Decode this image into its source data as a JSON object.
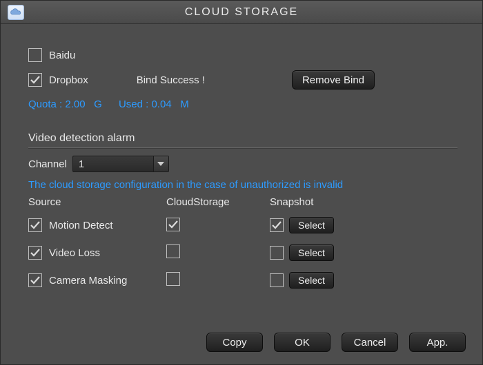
{
  "window": {
    "title": "CLOUD STORAGE"
  },
  "providers": {
    "baidu": {
      "label": "Baidu",
      "checked": false
    },
    "dropbox": {
      "label": "Dropbox",
      "checked": true,
      "status": "Bind Success !"
    }
  },
  "buttons": {
    "remove_bind": "Remove Bind",
    "select": "Select",
    "copy": "Copy",
    "ok": "OK",
    "cancel": "Cancel",
    "app": "App."
  },
  "quota": {
    "quota_label": "Quota :",
    "quota_value": "2.00",
    "quota_unit": "G",
    "used_label": "Used :",
    "used_value": "0.04",
    "used_unit": "M"
  },
  "section": {
    "title": "Video detection alarm"
  },
  "channel": {
    "label": "Channel",
    "value": "1"
  },
  "warning": "The cloud storage configuration in the case of unauthorized is invalid",
  "columns": {
    "source": "Source",
    "cloud": "CloudStorage",
    "snapshot": "Snapshot"
  },
  "rows": {
    "motion": {
      "label": "Motion Detect",
      "source": true,
      "cloud": true,
      "snapshot": true
    },
    "vloss": {
      "label": "Video Loss",
      "source": true,
      "cloud": false,
      "snapshot": false
    },
    "mask": {
      "label": "Camera Masking",
      "source": true,
      "cloud": false,
      "snapshot": false
    }
  }
}
